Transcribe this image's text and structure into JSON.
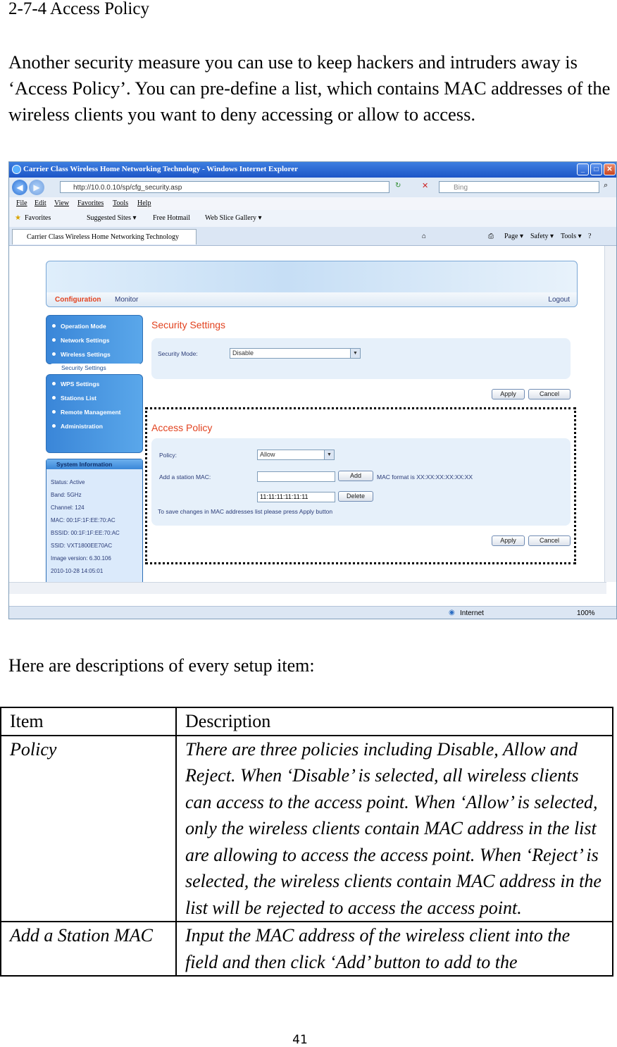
{
  "heading": "2-7-4 Access Policy",
  "intro": "Another security measure you can use to keep hackers and intruders away is ‘Access Policy’. You can pre-define a list, which contains MAC addresses of the wireless clients you want to deny accessing or allow to access.",
  "browser": {
    "window_title": "Carrier Class Wireless Home Networking Technology - Windows Internet Explorer",
    "address": "http://10.0.0.10/sp/cfg_security.asp",
    "search_placeholder": "Bing",
    "menu": [
      "File",
      "Edit",
      "View",
      "Favorites",
      "Tools",
      "Help"
    ],
    "favorites": [
      "Favorites",
      "Suggested Sites ▾",
      "Free Hotmail",
      "Web Slice Gallery ▾"
    ],
    "tab_title": "Carrier Class Wireless Home Networking Technology",
    "commands": [
      "Page ▾",
      "Safety ▾",
      "Tools ▾"
    ],
    "status_zone": "Internet",
    "zoom": "100%"
  },
  "router": {
    "banner": {
      "configuration": "Configuration",
      "monitor": "Monitor",
      "logout": "Logout"
    },
    "nav_top": [
      "Operation Mode",
      "Network Settings",
      "Wireless Settings"
    ],
    "nav_selected": "Security Settings",
    "nav_bottom": [
      "WPS Settings",
      "Stations List",
      "Remote Management",
      "Administration"
    ],
    "sysinfo": {
      "title": "System Information",
      "lines": [
        "Status: Active",
        "Band: 5GHz",
        "Channel: 124",
        "MAC: 00:1F:1F:EE:70:AC",
        "BSSID: 00:1F:1F:EE:70:AC",
        "SSID: VXT1800EE70AC",
        "Image version: 6.30.106",
        "2010-10-28 14:05:01"
      ]
    },
    "security": {
      "title": "Security Settings",
      "mode_label": "Security Mode:",
      "mode_value": "Disable",
      "apply": "Apply",
      "cancel": "Cancel"
    },
    "access": {
      "title": "Access Policy",
      "policy_label": "Policy:",
      "policy_value": "Allow",
      "add_label": "Add a station MAC:",
      "add_button": "Add",
      "mac_hint": "MAC format is XX:XX:XX:XX:XX:XX",
      "mac_entry": "11:11:11:11:11:11",
      "delete_button": "Delete",
      "save_note": "To save changes in MAC addresses list please press Apply button",
      "apply": "Apply",
      "cancel": "Cancel"
    }
  },
  "desc_intro": "Here are descriptions of every setup item:",
  "table": {
    "headers": [
      "Item",
      "Description"
    ],
    "rows": [
      {
        "item": "Policy",
        "description": "There are three policies including Disable, Allow and Reject. When ‘Disable’ is selected, all wireless clients can access to the access point. When ‘Allow’ is selected, only the wireless clients contain MAC address in the list are allowing to access the access point. When ‘Reject’ is selected, the wireless clients contain MAC address in the list will be rejected to access the access point."
      },
      {
        "item": "Add a Station MAC",
        "description": "Input the MAC address of the wireless client into the field and then click ‘Add’ button to add to the"
      }
    ]
  },
  "page_number": "41"
}
